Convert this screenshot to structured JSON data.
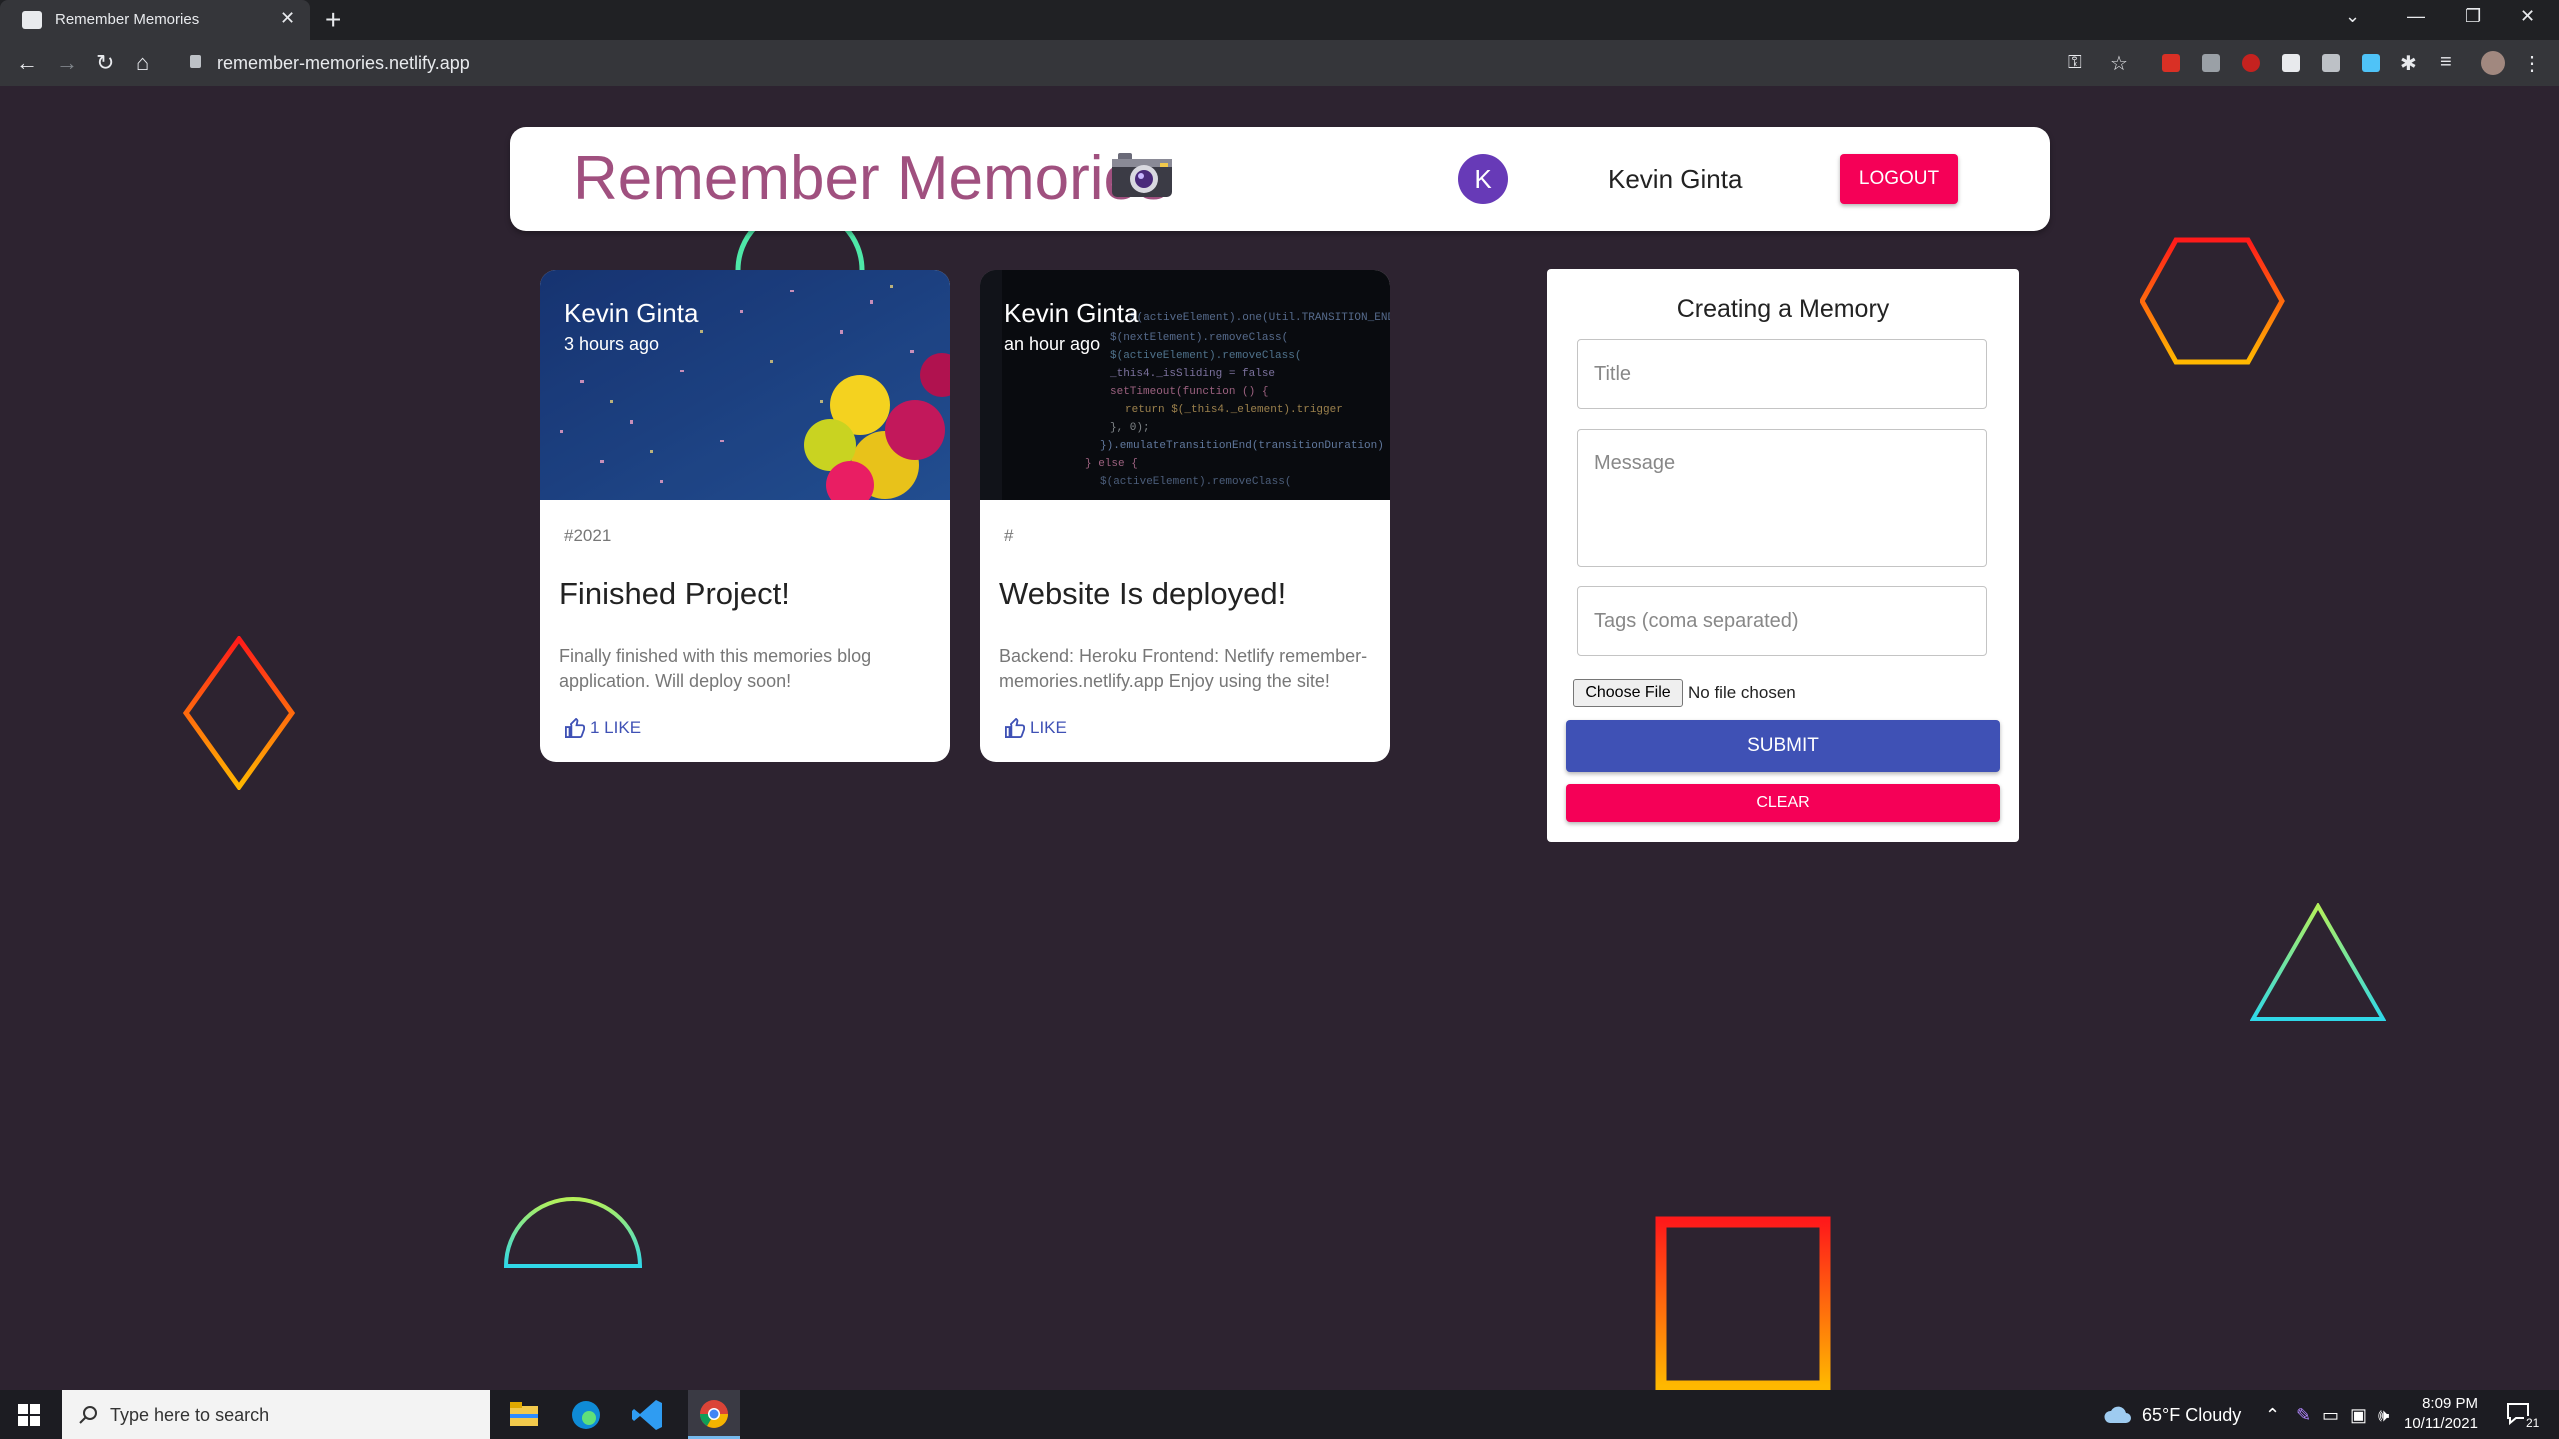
{
  "browser": {
    "tab_title": "Remember Memories",
    "url": "remember-memories.netlify.app"
  },
  "app": {
    "title": "Remember Memories",
    "avatar_letter": "K",
    "user_name": "Kevin Ginta",
    "logout_label": "LOGOUT"
  },
  "posts": [
    {
      "author": "Kevin Ginta",
      "time": "3 hours ago",
      "tags": "#2021",
      "title": "Finished Project!",
      "message": "Finally finished with this memories blog application. Will deploy soon!",
      "like_label": "1 LIKE"
    },
    {
      "author": "Kevin Ginta",
      "time": "an hour ago",
      "tags": "#",
      "title": "Website Is deployed!",
      "message": "Backend: Heroku Frontend: Netlify remember-memories.netlify.app Enjoy using the site!",
      "like_label": "LIKE"
    }
  ],
  "form": {
    "heading": "Creating a Memory",
    "title_placeholder": "Title",
    "message_placeholder": "Message",
    "tags_placeholder": "Tags (coma separated)",
    "file_button": "Choose File",
    "file_status": "No file chosen",
    "submit_label": "SUBMIT",
    "clear_label": "CLEAR"
  },
  "taskbar": {
    "search_placeholder": "Type here to search",
    "weather": "65°F  Cloudy",
    "time": "8:09 PM",
    "date": "10/11/2021",
    "notifications": "21"
  },
  "colors": {
    "background": "#2d2330",
    "title": "#a0507f",
    "accent_pink": "#f50057",
    "accent_blue": "#3f51b5",
    "avatar": "#673ab7"
  },
  "icons": [
    "camera-icon",
    "thumb-up-icon",
    "lock-icon",
    "star-icon",
    "windows-icon",
    "search-icon"
  ]
}
